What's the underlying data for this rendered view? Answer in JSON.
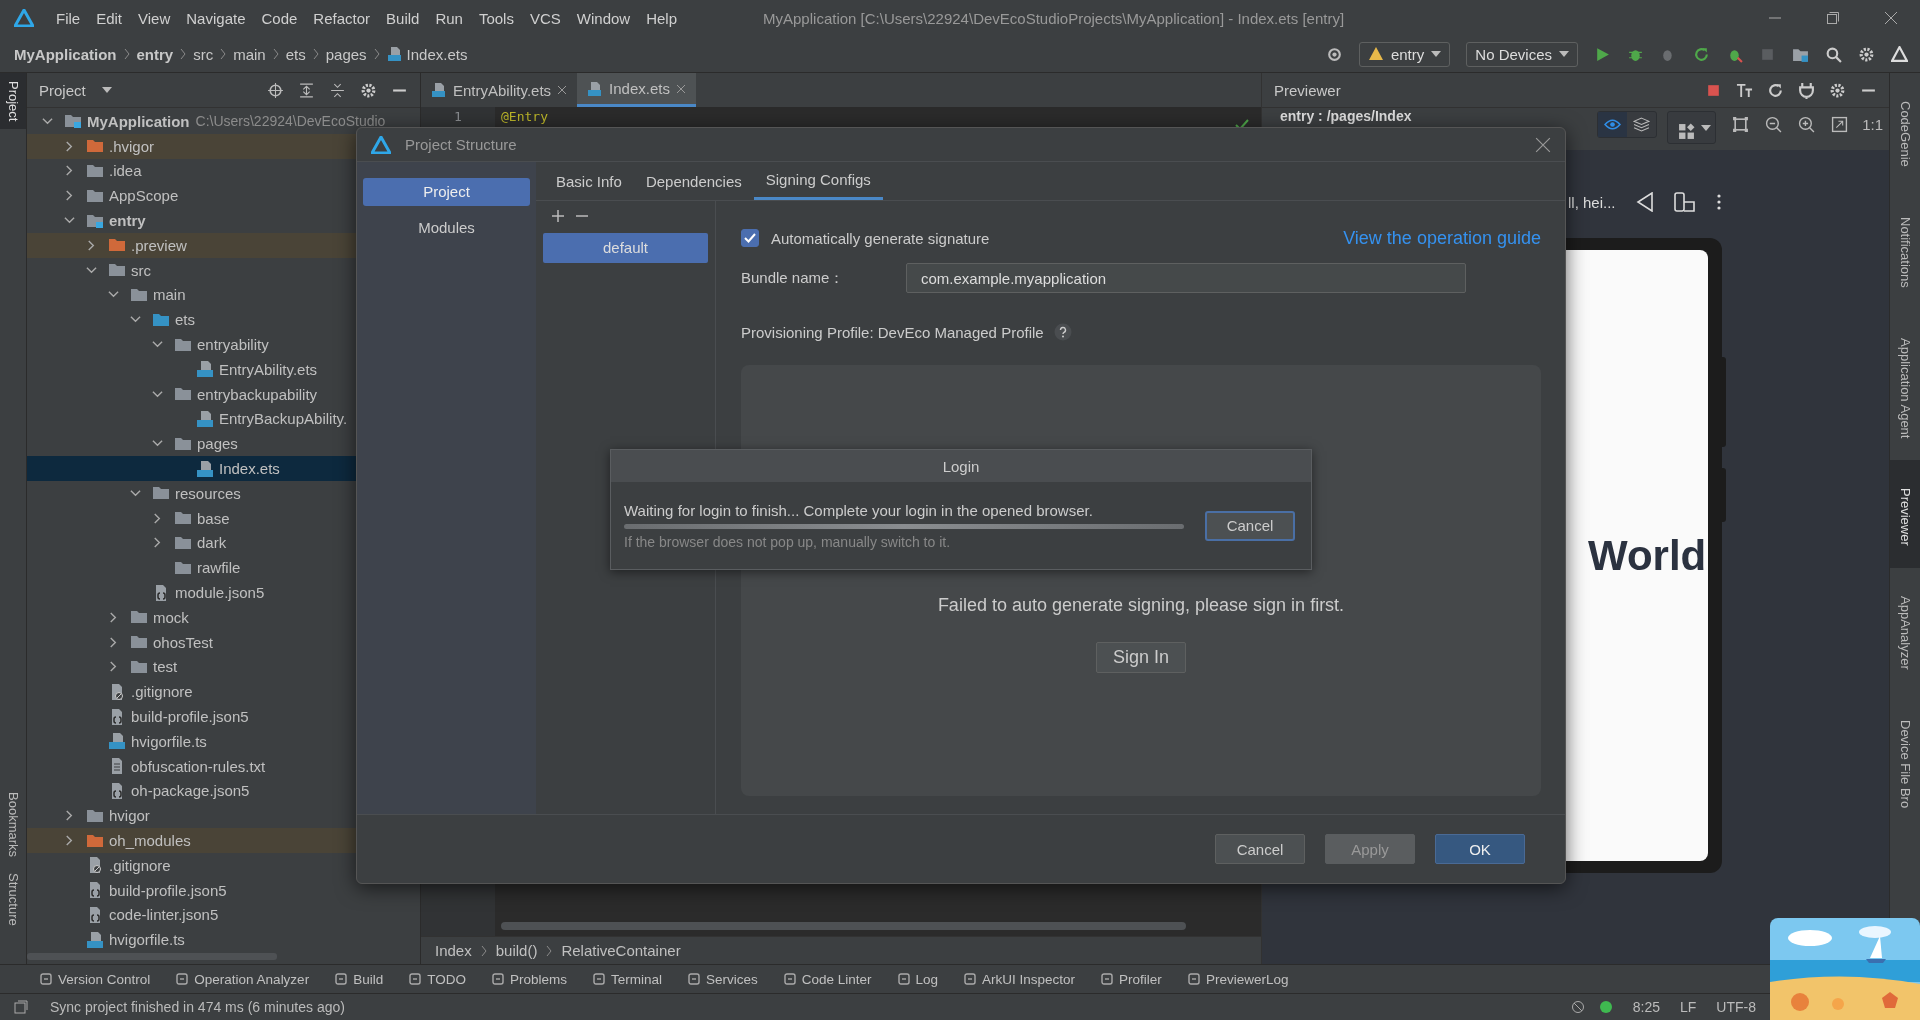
{
  "menu_bar": {
    "items": [
      "File",
      "Edit",
      "View",
      "Navigate",
      "Code",
      "Refactor",
      "Build",
      "Run",
      "Tools",
      "VCS",
      "Window",
      "Help"
    ],
    "window_title": "MyApplication [C:\\Users\\22924\\DevEcoStudioProjects\\MyApplication] - Index.ets [entry]"
  },
  "nav_bar": {
    "breadcrumb": [
      {
        "label": "MyApplication",
        "kind": "project"
      },
      {
        "label": "entry",
        "kind": "module"
      },
      {
        "label": "src",
        "kind": "folder"
      },
      {
        "label": "main",
        "kind": "folder"
      },
      {
        "label": "ets",
        "kind": "folder"
      },
      {
        "label": "pages",
        "kind": "folder"
      },
      {
        "label": "Index.ets",
        "kind": "file"
      }
    ],
    "module": "entry",
    "device": "No Devices"
  },
  "left_stripe": {
    "top": [
      {
        "label": "Project",
        "selected": true
      }
    ],
    "bottom": [
      {
        "label": "Bookmarks",
        "selected": false
      },
      {
        "label": "Structure",
        "selected": false
      }
    ]
  },
  "project_panel": {
    "title": "Project",
    "tree": [
      {
        "name": "MyApplication",
        "kind": "project",
        "path": "C:\\Users\\22924\\DevEcoStudio",
        "expanded": true,
        "selected": false,
        "children": [
          {
            "name": ".hvigor",
            "kind": "excluded",
            "expanded": false,
            "selected": false
          },
          {
            "name": ".idea",
            "kind": "folder",
            "expanded": false,
            "selected": false
          },
          {
            "name": "AppScope",
            "kind": "folder",
            "expanded": false,
            "selected": false
          },
          {
            "name": "entry",
            "kind": "module",
            "expanded": true,
            "selected": false,
            "children": [
              {
                "name": ".preview",
                "kind": "excluded",
                "expanded": false,
                "selected": false
              },
              {
                "name": "src",
                "kind": "folder",
                "expanded": true,
                "selected": false,
                "children": [
                  {
                    "name": "main",
                    "kind": "folder",
                    "expanded": true,
                    "selected": false,
                    "children": [
                      {
                        "name": "ets",
                        "kind": "source",
                        "expanded": true,
                        "selected": false,
                        "children": [
                          {
                            "name": "entryability",
                            "kind": "folder",
                            "expanded": true,
                            "selected": false,
                            "children": [
                              {
                                "name": "EntryAbility.ets",
                                "kind": "ets",
                                "selected": false
                              }
                            ]
                          },
                          {
                            "name": "entrybackupability",
                            "kind": "folder",
                            "expanded": true,
                            "selected": false,
                            "children": [
                              {
                                "name": "EntryBackupAbility.",
                                "kind": "ets",
                                "selected": false
                              }
                            ]
                          },
                          {
                            "name": "pages",
                            "kind": "folder",
                            "expanded": true,
                            "selected": false,
                            "children": [
                              {
                                "name": "Index.ets",
                                "kind": "ets",
                                "selected": true
                              }
                            ]
                          }
                        ]
                      },
                      {
                        "name": "resources",
                        "kind": "folder",
                        "expanded": true,
                        "selected": false,
                        "children": [
                          {
                            "name": "base",
                            "kind": "folder",
                            "expanded": false,
                            "selected": false
                          },
                          {
                            "name": "dark",
                            "kind": "folder",
                            "expanded": false,
                            "selected": false
                          },
                          {
                            "name": "rawfile",
                            "kind": "folder",
                            "selected": false
                          }
                        ]
                      },
                      {
                        "name": "module.json5",
                        "kind": "json",
                        "selected": false
                      }
                    ]
                  },
                  {
                    "name": "mock",
                    "kind": "folder",
                    "expanded": false,
                    "selected": false
                  },
                  {
                    "name": "ohosTest",
                    "kind": "folder",
                    "expanded": false,
                    "selected": false
                  },
                  {
                    "name": "test",
                    "kind": "folder",
                    "expanded": false,
                    "selected": false
                  }
                ]
              },
              {
                "name": ".gitignore",
                "kind": "ignore",
                "selected": false
              },
              {
                "name": "build-profile.json5",
                "kind": "json",
                "selected": false
              },
              {
                "name": "hvigorfile.ts",
                "kind": "ts",
                "selected": false
              },
              {
                "name": "obfuscation-rules.txt",
                "kind": "txt",
                "selected": false
              },
              {
                "name": "oh-package.json5",
                "kind": "json",
                "selected": false
              }
            ]
          },
          {
            "name": "hvigor",
            "kind": "folder",
            "expanded": false,
            "selected": false
          },
          {
            "name": "oh_modules",
            "kind": "excluded",
            "expanded": false,
            "selected": false
          },
          {
            "name": ".gitignore",
            "kind": "ignore",
            "selected": false
          },
          {
            "name": "build-profile.json5",
            "kind": "json",
            "selected": false
          },
          {
            "name": "code-linter.json5",
            "kind": "json",
            "selected": false
          },
          {
            "name": "hvigorfile.ts",
            "kind": "ts",
            "selected": false
          }
        ]
      }
    ]
  },
  "editor": {
    "tabs": [
      {
        "label": "EntryAbility.ets",
        "selected": false
      },
      {
        "label": "Index.ets",
        "selected": true
      }
    ],
    "lines": [
      {
        "number": "1",
        "code": "@Entry"
      }
    ],
    "breadcrumb": [
      "Index",
      "build()",
      "RelativeContainer"
    ]
  },
  "previewer": {
    "title": "Previewer",
    "page": "entry : /pages/Index",
    "view_modes": [
      {
        "kind": "inspect",
        "selected": true
      },
      {
        "kind": "layers",
        "selected": false
      }
    ],
    "zoom_label": "1:1",
    "device": "ll, hei...",
    "screen_text": "World"
  },
  "right_stripe": [
    {
      "label": "CodeGenie",
      "selected": false
    },
    {
      "label": "Notifications",
      "selected": false
    },
    {
      "label": "Application Agent",
      "selected": false
    },
    {
      "label": "Previewer",
      "selected": true
    },
    {
      "label": "AppAnalyzer",
      "selected": false
    },
    {
      "label": "Device File Bro",
      "selected": false
    }
  ],
  "tool_windows": [
    "Version Control",
    "Operation Analyzer",
    "Build",
    "TODO",
    "Problems",
    "Terminal",
    "Services",
    "Code Linter",
    "Log",
    "ArkUI Inspector",
    "Profiler",
    "PreviewerLog"
  ],
  "status_bar": {
    "message": "Sync project finished in 474 ms (6 minutes ago)",
    "position": "8:25",
    "line_ending": "LF",
    "encoding": "UTF-8"
  },
  "dialog": {
    "title": "Project Structure",
    "sidebar": [
      {
        "label": "Project",
        "selected": true
      },
      {
        "label": "Modules",
        "selected": false
      }
    ],
    "tabs": [
      {
        "label": "Basic Info",
        "selected": false
      },
      {
        "label": "Dependencies",
        "selected": false
      },
      {
        "label": "Signing Configs",
        "selected": true
      }
    ],
    "configs": [
      {
        "label": "default",
        "selected": true
      }
    ],
    "auto_sign": {
      "label": "Automatically generate signature",
      "checked": true
    },
    "guide_link": "View the operation guide",
    "bundle": {
      "label": "Bundle name：",
      "value": "com.example.myapplication"
    },
    "profile": "Provisioning Profile: DevEco Managed Profile",
    "message": "Failed to auto generate signing, please sign in first.",
    "sign_in": "Sign In",
    "buttons": [
      {
        "label": "Cancel",
        "kind": "normal"
      },
      {
        "label": "Apply",
        "kind": "disabled"
      },
      {
        "label": "OK",
        "kind": "primary"
      }
    ]
  },
  "login": {
    "title": "Login",
    "message": "Waiting for login to finish... Complete your login in the opened browser.",
    "level": 1,
    "hint": "If the browser does not pop up, manually switch to it.",
    "cancel": "Cancel"
  }
}
